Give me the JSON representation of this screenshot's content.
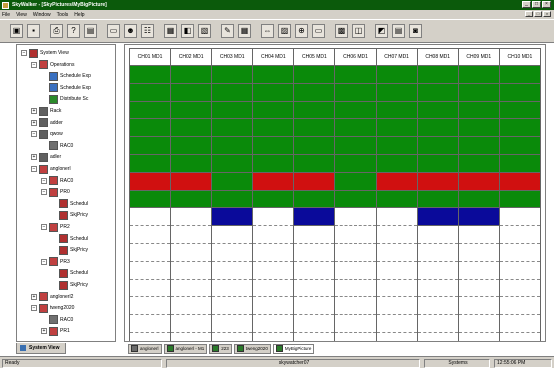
{
  "window": {
    "title": "SkyWalker - [SkyPictures\\MyBigPicture]",
    "controls": [
      "_",
      "□",
      "×"
    ]
  },
  "menu": {
    "items": [
      "File",
      "View",
      "Window",
      "Tools",
      "Help"
    ],
    "mdi_controls": [
      "_",
      "□",
      "×"
    ]
  },
  "toolbar": {
    "buttons": [
      {
        "name": "open-icon",
        "glyph": "▣"
      },
      {
        "name": "save-icon",
        "glyph": "▪"
      },
      {
        "name": "print-icon",
        "glyph": "⎙"
      },
      {
        "name": "help-icon",
        "glyph": "?"
      },
      {
        "name": "properties-icon",
        "glyph": "▤"
      },
      {
        "name": "monitor-icon",
        "glyph": "▭"
      },
      {
        "name": "users-icon",
        "glyph": "☻"
      },
      {
        "name": "network-icon",
        "glyph": "☷"
      },
      {
        "name": "chart-icon",
        "glyph": "▦"
      },
      {
        "name": "toggle-icon",
        "glyph": "◧"
      },
      {
        "name": "print-preview-icon",
        "glyph": "▧"
      },
      {
        "name": "edit-icon",
        "glyph": "✎"
      },
      {
        "name": "grid-icon",
        "glyph": "▦"
      },
      {
        "name": "move-icon",
        "glyph": "⇔"
      },
      {
        "name": "layout-icon",
        "glyph": "▨"
      },
      {
        "name": "zoom-icon",
        "glyph": "⊕"
      },
      {
        "name": "window-icon",
        "glyph": "▭"
      },
      {
        "name": "picture-icon",
        "glyph": "▩"
      },
      {
        "name": "tile-icon",
        "glyph": "◫"
      },
      {
        "name": "cascade-icon",
        "glyph": "◩"
      },
      {
        "name": "arrange-icon",
        "glyph": "▤"
      },
      {
        "name": "lock-icon",
        "glyph": "◙"
      }
    ]
  },
  "tree": {
    "nodes": [
      {
        "label": "System View",
        "exp": "−",
        "icon": "#b03030",
        "depth": 0
      },
      {
        "label": "Operations",
        "exp": "−",
        "icon": "#c04040",
        "depth": 1
      },
      {
        "label": "Schedule Exp",
        "exp": "",
        "icon": "#3a70c0",
        "depth": 2
      },
      {
        "label": "Schedule Exp",
        "exp": "",
        "icon": "#3a70c0",
        "depth": 2
      },
      {
        "label": "Distribute Sc",
        "exp": "",
        "icon": "#2a8a2a",
        "depth": 2
      },
      {
        "label": "Rack",
        "exp": "+",
        "icon": "#606060",
        "depth": 1
      },
      {
        "label": "adder",
        "exp": "+",
        "icon": "#606060",
        "depth": 1
      },
      {
        "label": "qwow",
        "exp": "−",
        "icon": "#606060",
        "depth": 1
      },
      {
        "label": "RAC0",
        "exp": "",
        "icon": "#707070",
        "depth": 2
      },
      {
        "label": "adler",
        "exp": "+",
        "icon": "#606060",
        "depth": 1
      },
      {
        "label": "anglonerl",
        "exp": "−",
        "icon": "#c04040",
        "depth": 1
      },
      {
        "label": "RAC0",
        "exp": "−",
        "icon": "#c04040",
        "depth": 2
      },
      {
        "label": "PR0",
        "exp": "−",
        "icon": "#c04040",
        "depth": 2
      },
      {
        "label": "Schedul",
        "exp": "",
        "icon": "#b03030",
        "depth": 3
      },
      {
        "label": "SkjPricy",
        "exp": "",
        "icon": "#b03030",
        "depth": 3
      },
      {
        "label": "PR2",
        "exp": "−",
        "icon": "#c04040",
        "depth": 2
      },
      {
        "label": "Schedul",
        "exp": "",
        "icon": "#b03030",
        "depth": 3
      },
      {
        "label": "SkjPricy",
        "exp": "",
        "icon": "#b03030",
        "depth": 3
      },
      {
        "label": "PR3",
        "exp": "−",
        "icon": "#c04040",
        "depth": 2
      },
      {
        "label": "Schedul",
        "exp": "",
        "icon": "#b03030",
        "depth": 3
      },
      {
        "label": "SkjPricy",
        "exp": "",
        "icon": "#b03030",
        "depth": 3
      },
      {
        "label": "anglonerl2",
        "exp": "+",
        "icon": "#c04040",
        "depth": 1
      },
      {
        "label": "tweng2020",
        "exp": "−",
        "icon": "#c04040",
        "depth": 1
      },
      {
        "label": "RAC0",
        "exp": "",
        "icon": "#707070",
        "depth": 2
      },
      {
        "label": "PR1",
        "exp": "+",
        "icon": "#c04040",
        "depth": 2
      }
    ],
    "tab_label": "System View"
  },
  "grid": {
    "headers": [
      "CH01 MD1",
      "CH02 MD1",
      "CH03 MD1",
      "CH04 MD1",
      "CH05 MD1",
      "CH06 MD1",
      "CH07 MD1",
      "CH08 MD1",
      "CH09 MD1",
      "CH10 MD1"
    ],
    "colors": {
      "G": "#0a8a0a",
      "R": "#d01010",
      "B": "#0a0a9a",
      "W": "#ffffff"
    },
    "rows": [
      "GGGGGGGGGG",
      "GGGGGGGGGG",
      "GGGGGGGGGG",
      "GGGGGGGGGG",
      "GGGGGGGGGG",
      "GGGGGGGGGG",
      "RRGRRGRRRR",
      "GGGGGGGGGG",
      "WWBWBWWBBW",
      "WWWWWWWWWW",
      "WWWWWWWWWW",
      "WWWWWWWWWW",
      "WWWWWWWWWW",
      "WWWWWWWWWW",
      "WWWWWWWWWW",
      "WWWWWWWWWW"
    ]
  },
  "bottom_tabs": [
    {
      "label": "anglonerl",
      "icon": "#6a6a6a"
    },
    {
      "label": "anglonerl - M1",
      "icon": "#2a7a2a"
    },
    {
      "label": "223",
      "icon": "#2a7a2a"
    },
    {
      "label": "tweng2020",
      "icon": "#2a7a2a"
    },
    {
      "label": "MyBigPicture",
      "icon": "#2a7a2a"
    }
  ],
  "status": {
    "ready": "Ready",
    "center": "skywatcher07",
    "system": "Systems",
    "time": "12:55:06 PM"
  }
}
